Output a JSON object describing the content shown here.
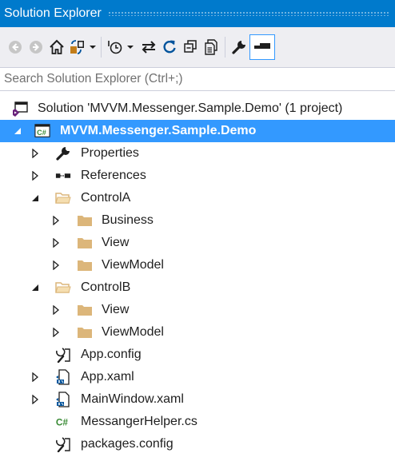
{
  "window": {
    "title": "Solution Explorer"
  },
  "toolbar": {
    "buttons": [
      {
        "name": "back-button",
        "icon": "back-arrow-icon"
      },
      {
        "name": "forward-button",
        "icon": "forward-arrow-icon"
      },
      {
        "name": "home-button",
        "icon": "home-icon"
      },
      {
        "name": "switch-views-button",
        "icon": "switch-views-icon"
      },
      {
        "name": "pending-changes-filter-button",
        "icon": "pending-changes-icon"
      },
      {
        "name": "sync-with-active-document-button",
        "icon": "sync-arrows-icon"
      },
      {
        "name": "refresh-button",
        "icon": "refresh-icon"
      },
      {
        "name": "collapse-all-button",
        "icon": "collapse-all-icon"
      },
      {
        "name": "show-all-files-button",
        "icon": "show-all-files-icon"
      },
      {
        "name": "properties-button",
        "icon": "wrench-icon"
      },
      {
        "name": "preview-selected-items-button",
        "icon": "preview-icon"
      }
    ]
  },
  "search": {
    "placeholder": "Search Solution Explorer (Ctrl+;)",
    "value": ""
  },
  "tree": {
    "solution": "Solution 'MVVM.Messenger.Sample.Demo' (1 project)",
    "project": "MVVM.Messenger.Sample.Demo",
    "properties": "Properties",
    "references": "References",
    "controlA": "ControlA",
    "controlA_business": "Business",
    "controlA_view": "View",
    "controlA_viewmodel": "ViewModel",
    "controlB": "ControlB",
    "controlB_view": "View",
    "controlB_viewmodel": "ViewModel",
    "app_config": "App.config",
    "app_xaml": "App.xaml",
    "mainwindow_xaml": "MainWindow.xaml",
    "messenger_helper": "MessangerHelper.cs",
    "packages_config": "packages.config"
  },
  "colors": {
    "accent": "#007acc",
    "selection": "#3399ff",
    "toolbar_bg": "#eeeef2",
    "folder": "#dcb67a",
    "csharp": "#388a34"
  }
}
